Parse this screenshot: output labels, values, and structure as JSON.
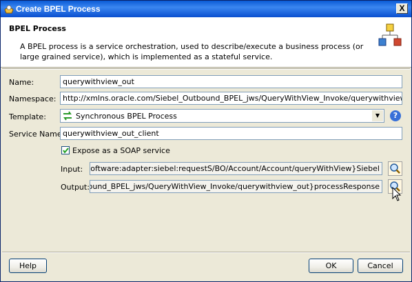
{
  "window": {
    "title": "Create BPEL Process",
    "close_label": "X"
  },
  "header": {
    "title": "BPEL Process",
    "description": "A BPEL process is a service orchestration, used to describe/execute a business process (or large grained service), which is implemented as a stateful service."
  },
  "form": {
    "name_label": "Name:",
    "name_value": "querywithview_out",
    "namespace_label": "Namespace:",
    "namespace_value": "http://xmlns.oracle.com/Siebel_Outbound_BPEL_jws/QueryWithView_Invoke/querywithview_out",
    "template_label": "Template:",
    "template_value": "Synchronous BPEL Process",
    "help_label": "?",
    "service_name_label": "Service Name:",
    "service_name_value": "querywithview_out_client",
    "expose_label": "Expose as a SOAP service",
    "expose_checked": true,
    "input_label": "Input:",
    "input_value": "urn:iwaysoftware:adapter:siebel:requestS/BO/Account/Account/queryWithView}Siebel",
    "output_label": "Output:",
    "output_value": "bel_Outbound_BPEL_jws/QueryWithView_Invoke/querywithview_out}processResponse"
  },
  "buttons": {
    "help": "Help",
    "ok": "OK",
    "cancel": "Cancel"
  }
}
